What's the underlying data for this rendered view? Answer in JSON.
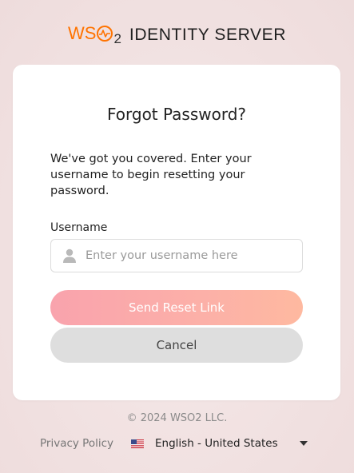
{
  "logo": {
    "brand_letters": "WS",
    "brand_sub": "2",
    "product": "IDENTITY SERVER",
    "brand_color": "#ff7300"
  },
  "form": {
    "title": "Forgot Password?",
    "description": "We've got you covered. Enter your username to begin resetting your password.",
    "username_label": "Username",
    "username_placeholder": "Enter your username here",
    "username_value": "",
    "username_icon": "user-icon",
    "submit_label": "Send Reset Link",
    "cancel_label": "Cancel"
  },
  "footer": {
    "copyright": "© 2024 WSO2 LLC.",
    "privacy_label": "Privacy Policy",
    "language_label": "English - United States",
    "language_flag_icon": "us-flag-icon",
    "language_caret_icon": "caret-down-icon"
  },
  "colors": {
    "accent": "#ff7300",
    "primary_button_gradient_start": "#f9a3ad",
    "primary_button_gradient_end": "#feb9a0",
    "cancel_button": "#dedede"
  }
}
